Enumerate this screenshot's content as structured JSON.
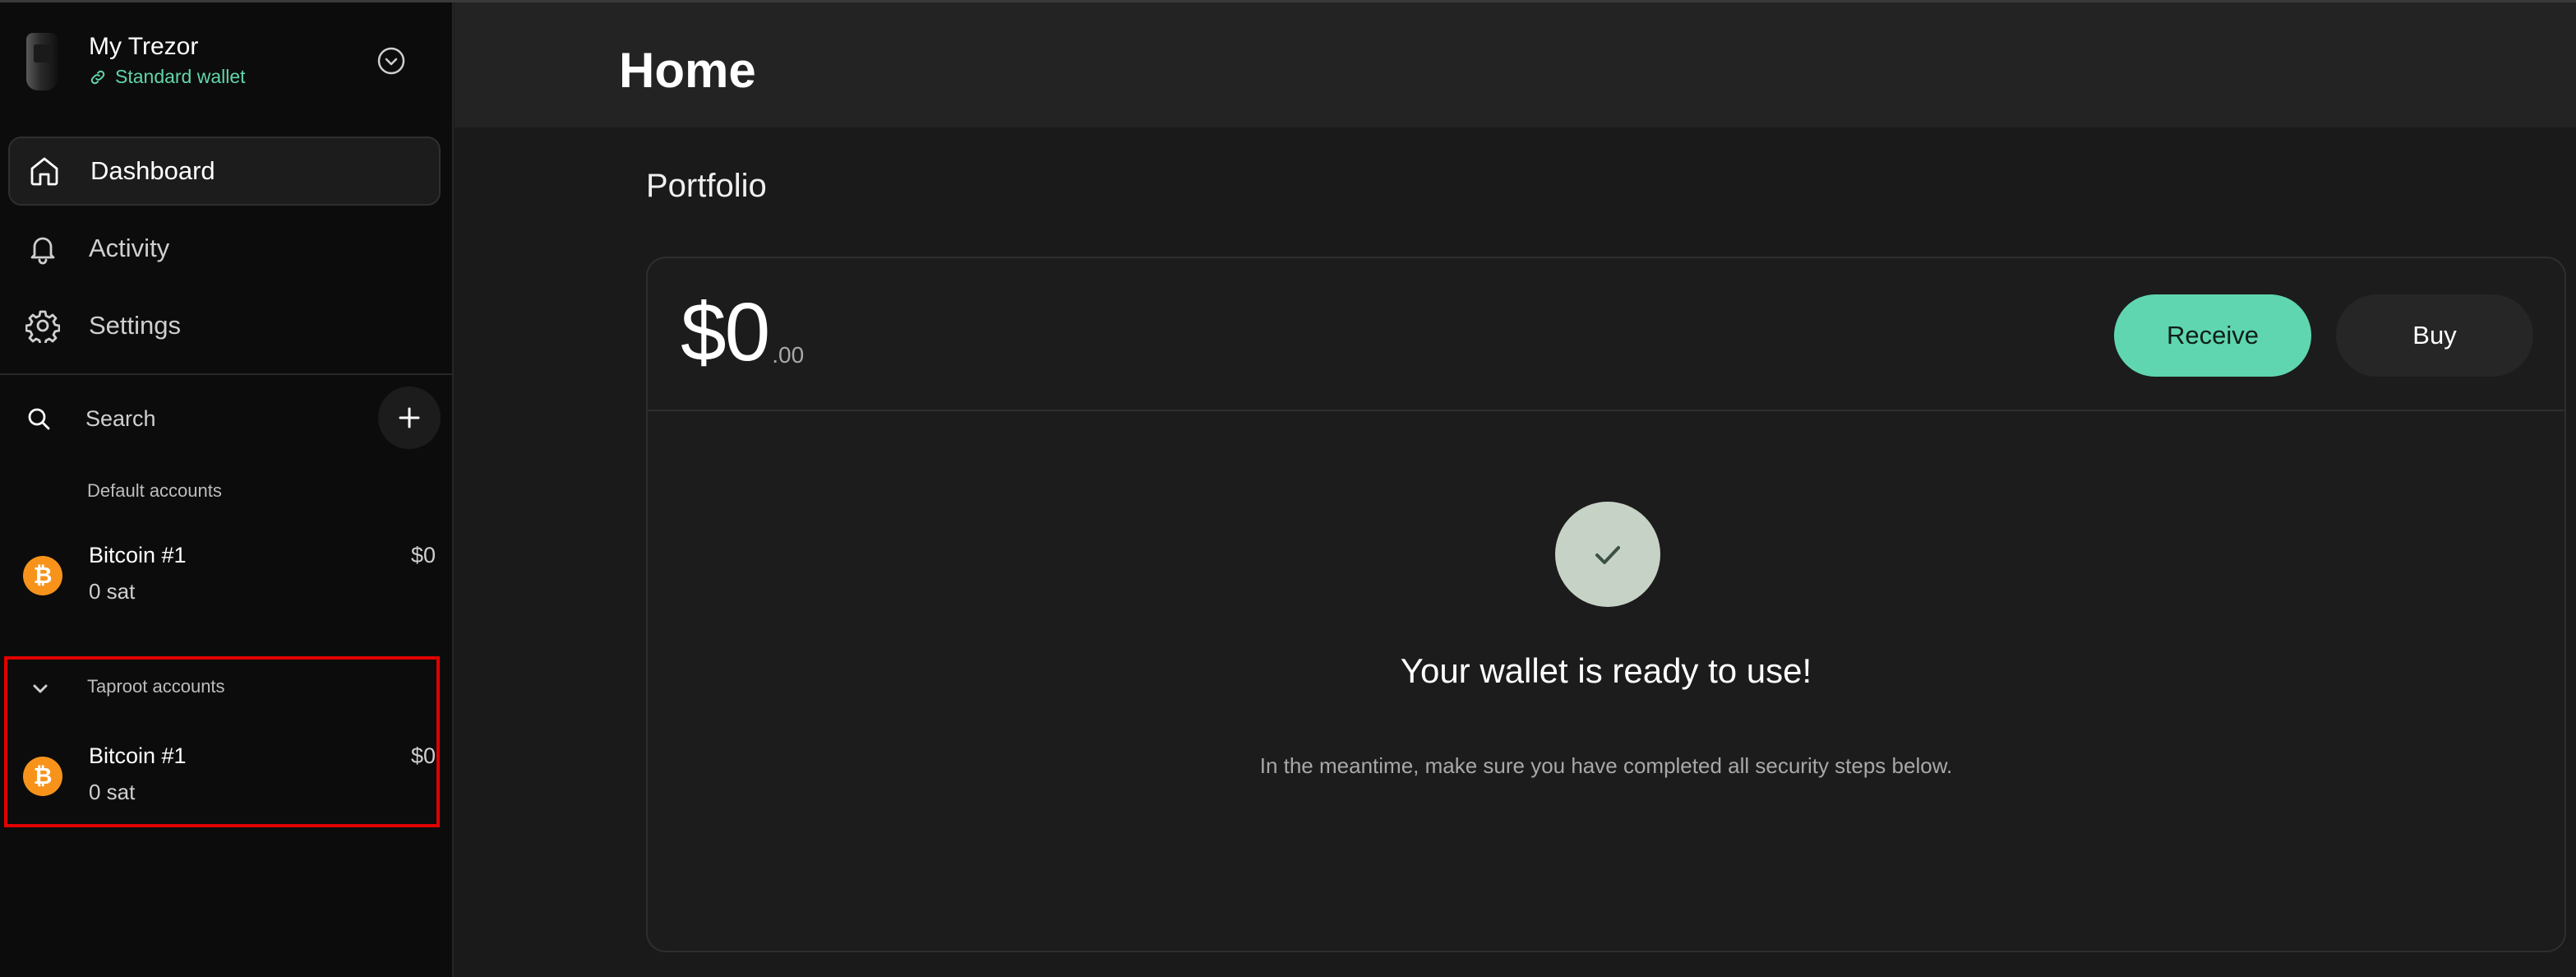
{
  "device": {
    "name": "My Trezor",
    "wallet_type": "Standard wallet"
  },
  "nav": {
    "items": [
      {
        "label": "Dashboard",
        "icon": "home-icon",
        "active": true
      },
      {
        "label": "Activity",
        "icon": "bell-icon",
        "active": false
      },
      {
        "label": "Settings",
        "icon": "gear-icon",
        "active": false
      }
    ]
  },
  "search": {
    "label": "Search"
  },
  "accounts": {
    "default_title": "Default accounts",
    "default_items": [
      {
        "name": "Bitcoin #1",
        "amount": "0 sat",
        "fiat": "$0",
        "icon": "bitcoin-icon"
      }
    ],
    "taproot_title": "Taproot accounts",
    "taproot_items": [
      {
        "name": "Bitcoin #1",
        "amount": "0 sat",
        "fiat": "$0",
        "icon": "bitcoin-icon"
      }
    ]
  },
  "header": {
    "title": "Home"
  },
  "portfolio": {
    "title": "Portfolio",
    "balance_int": "$0",
    "balance_dec": ".00",
    "receive_label": "Receive",
    "buy_label": "Buy",
    "ready_title": "Your wallet is ready to use!",
    "ready_subtitle": "In the meantime, make sure you have completed all security steps below."
  },
  "colors": {
    "accent": "#5fd6b0",
    "wallet_type": "#62d5a9",
    "bitcoin": "#f7931a",
    "highlight": "#e10000"
  }
}
